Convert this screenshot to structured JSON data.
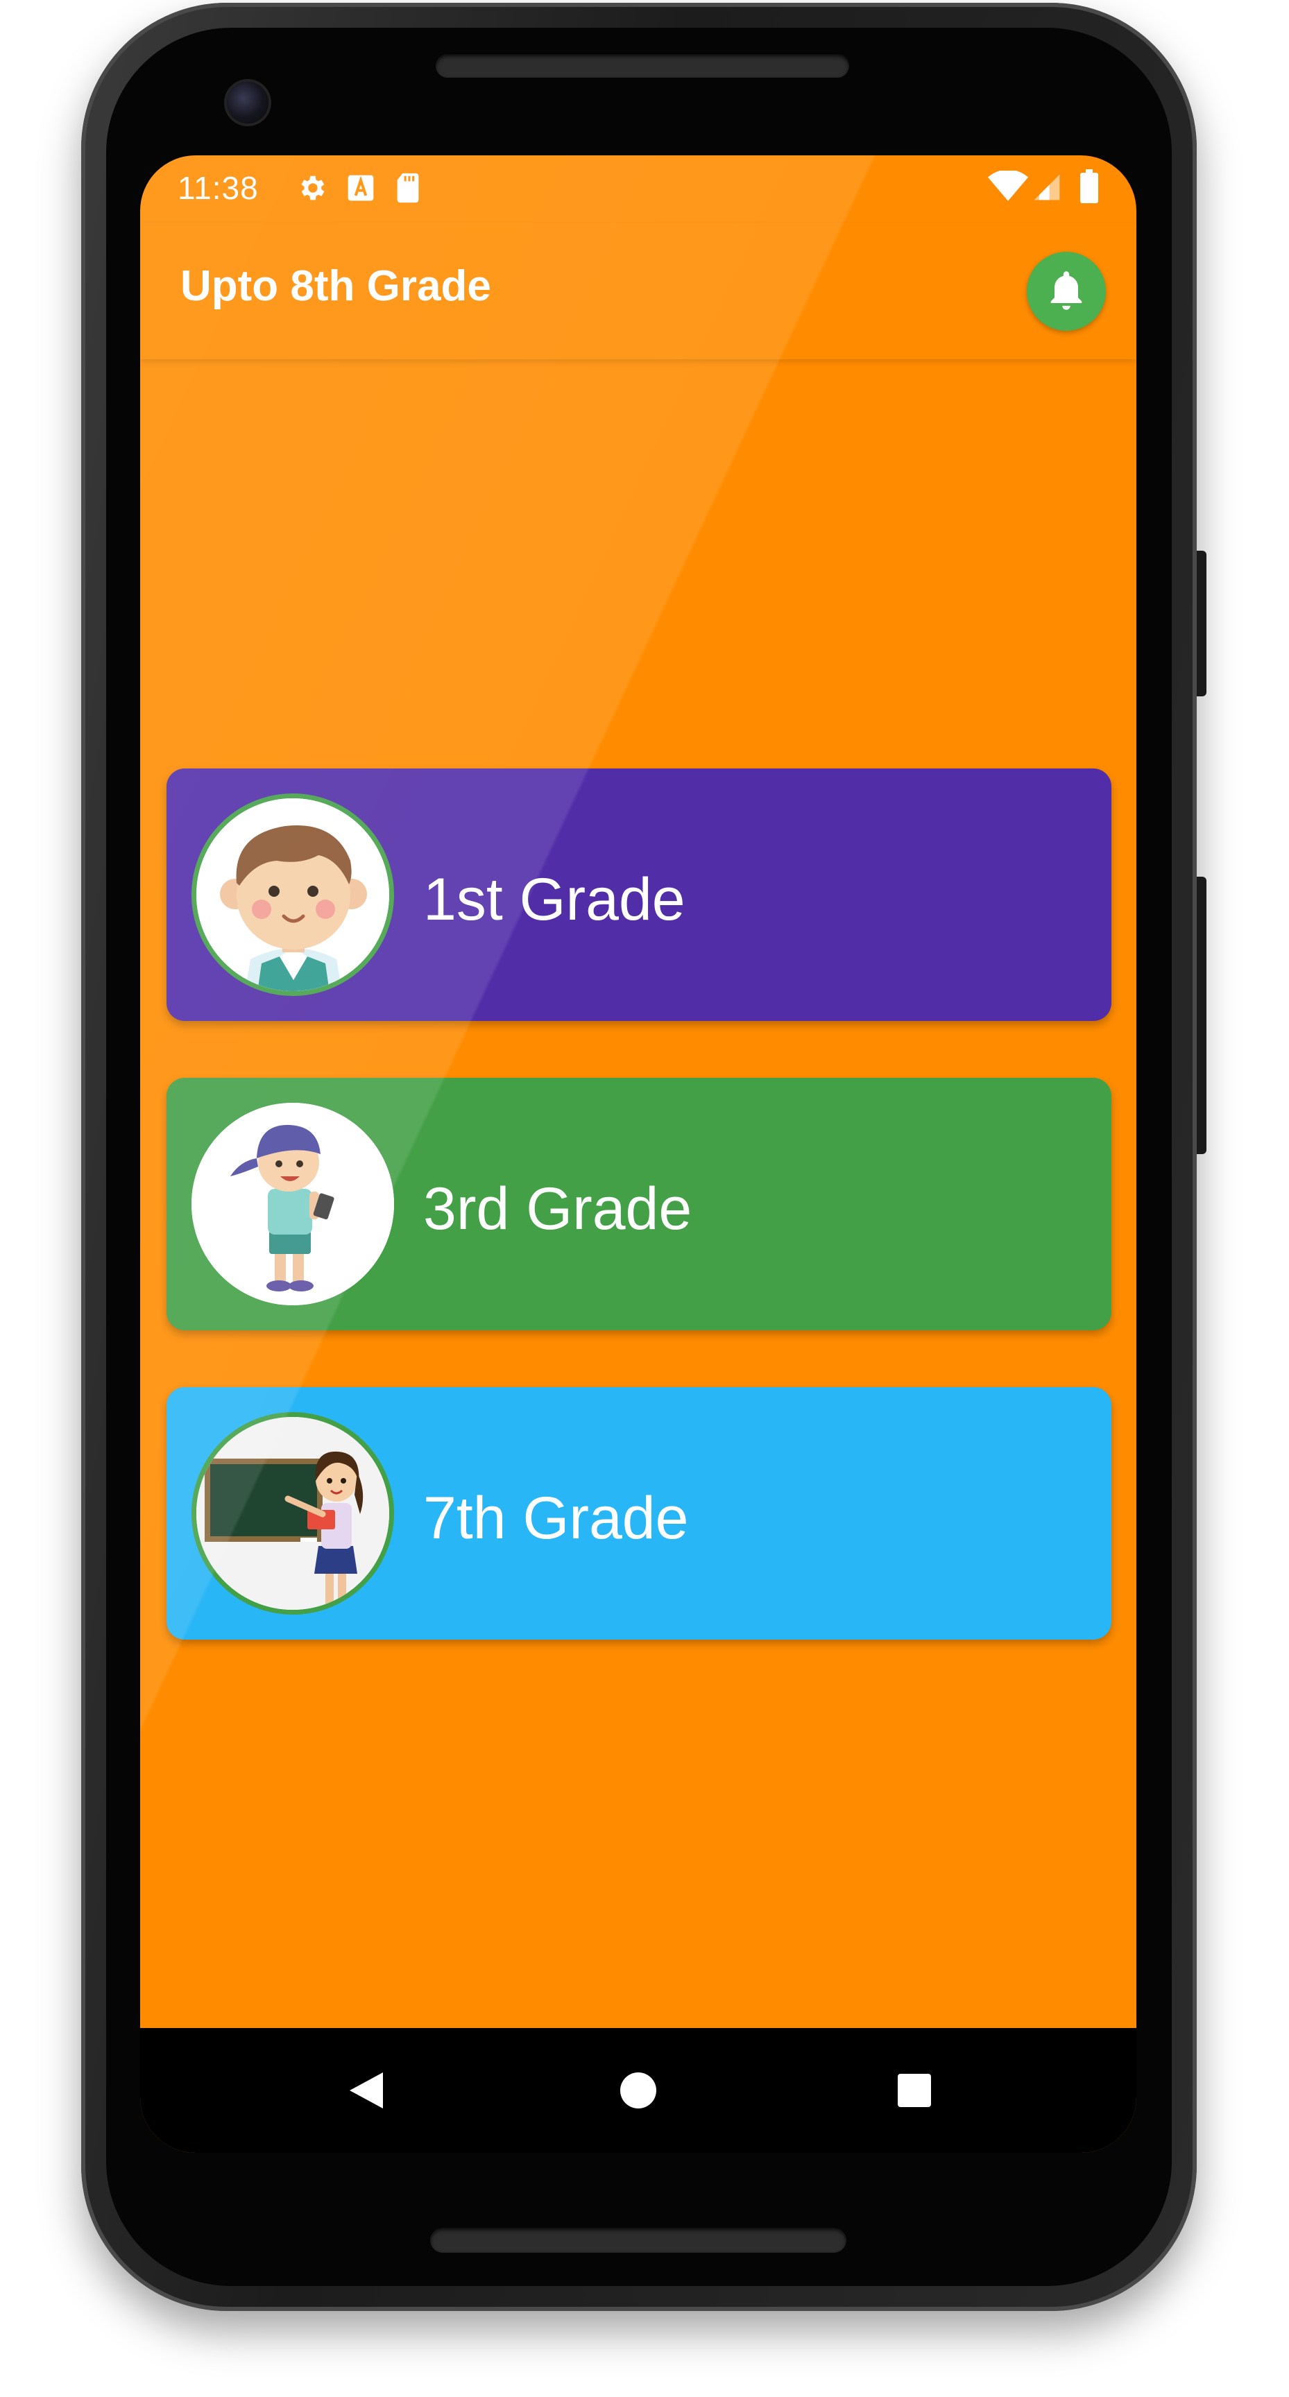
{
  "status_bar": {
    "time": "11:38",
    "left_icons": [
      "gear-icon",
      "text-a-icon",
      "sd-card-icon"
    ],
    "right_icons": [
      "wifi-icon",
      "signal-icon",
      "battery-icon"
    ]
  },
  "app_bar": {
    "title": "Upto 8th Grade",
    "action_icon": "bell-icon"
  },
  "grades": [
    {
      "label": "1st Grade",
      "color": "#512da8",
      "avatar": "boy-avatar"
    },
    {
      "label": "3rd Grade",
      "color": "#43a047",
      "avatar": "boy-with-tablet-avatar"
    },
    {
      "label": "7th Grade",
      "color": "#29b6f6",
      "avatar": "teacher-at-blackboard-avatar"
    }
  ],
  "nav_bar": {
    "buttons": [
      "back-icon",
      "home-icon",
      "recents-icon"
    ]
  },
  "colors": {
    "background": "#ff8c00",
    "bell_button": "#4caf50",
    "avatar_ring": "#43a047"
  }
}
